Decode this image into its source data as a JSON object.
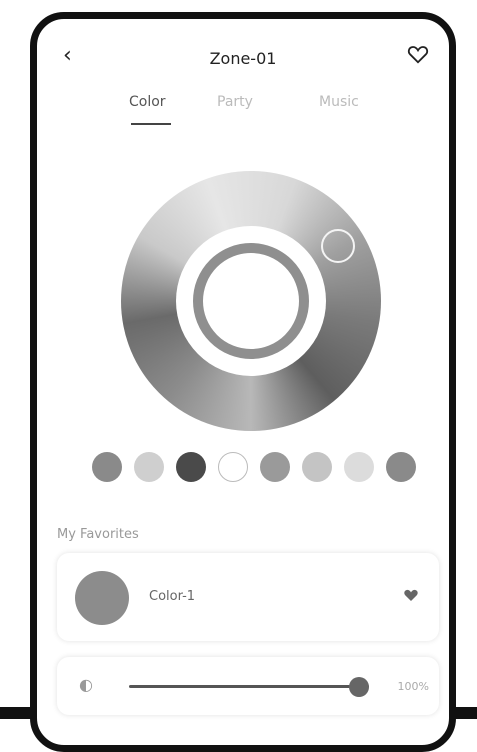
{
  "header": {
    "title": "Zone-01",
    "back_glyph": "‹"
  },
  "tabs": [
    {
      "label": "Color",
      "active": true
    },
    {
      "label": "Party",
      "active": false
    },
    {
      "label": "Music",
      "active": false
    }
  ],
  "color_wheel": {
    "accent": "#8f8f8f"
  },
  "swatches": [
    "#8a8a8a",
    "#cfcfcf",
    "#4a4a4a",
    "#ffffff",
    "#9a9a9a",
    "#c4c4c4",
    "#dcdcdc",
    "#8a8a8a"
  ],
  "favorites": {
    "section_label": "My Favorites",
    "items": [
      {
        "name": "Color-1",
        "color": "#8c8c8c"
      }
    ]
  },
  "brightness": {
    "value": "100%",
    "level": 1.0
  }
}
